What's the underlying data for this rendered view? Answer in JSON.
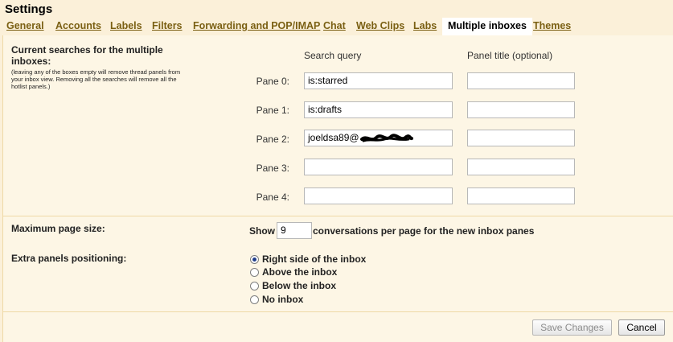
{
  "title": "Settings",
  "tabs": [
    {
      "label": "General",
      "active": false
    },
    {
      "label": "Accounts",
      "active": false
    },
    {
      "label": "Labels",
      "active": false
    },
    {
      "label": "Filters",
      "active": false
    },
    {
      "label": "Forwarding and POP/IMAP",
      "active": false
    },
    {
      "label": "Chat",
      "active": false
    },
    {
      "label": "Web Clips",
      "active": false
    },
    {
      "label": "Labs",
      "active": false
    },
    {
      "label": "Multiple inboxes",
      "active": true
    },
    {
      "label": "Themes",
      "active": false
    }
  ],
  "searches": {
    "heading": "Current searches for the multiple inboxes:",
    "note": "(leaving any of the boxes empty will remove thread panels from your inbox view. Removing all the searches will remove all the hotlist panels.)",
    "col_query": "Search query",
    "col_title": "Panel title (optional)",
    "panes": [
      {
        "label": "Pane 0:",
        "query": "is:starred",
        "title": ""
      },
      {
        "label": "Pane 1:",
        "query": "is:drafts",
        "title": ""
      },
      {
        "label": "Pane 2:",
        "query": "joeldsa89@",
        "title": ""
      },
      {
        "label": "Pane 3:",
        "query": "",
        "title": ""
      },
      {
        "label": "Pane 4:",
        "query": "",
        "title": ""
      }
    ]
  },
  "page_size": {
    "label": "Maximum page size:",
    "show": "Show",
    "value": "9",
    "suffix": "conversations per page for the new inbox panes"
  },
  "positioning": {
    "label": "Extra panels positioning:",
    "options": [
      {
        "label": "Right side of the inbox",
        "checked": true
      },
      {
        "label": "Above the inbox",
        "checked": false
      },
      {
        "label": "Below the inbox",
        "checked": false
      },
      {
        "label": "No inbox",
        "checked": false
      }
    ]
  },
  "buttons": {
    "save": "Save Changes",
    "cancel": "Cancel"
  }
}
